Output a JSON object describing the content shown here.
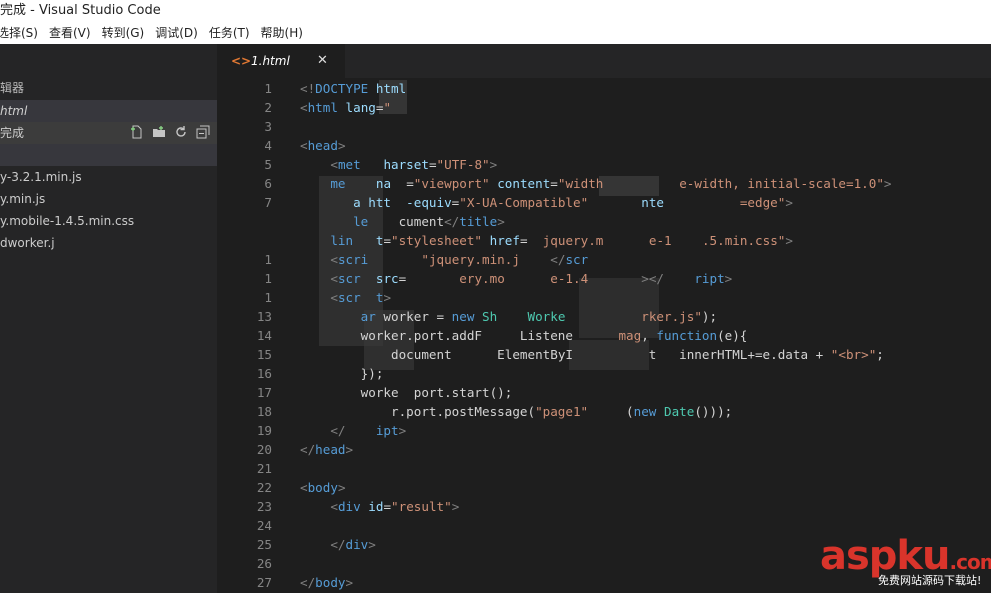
{
  "window": {
    "title": "完成 - Visual Studio Code"
  },
  "menu": [
    "选择(S)",
    "查看(V)",
    "转到(G)",
    "调试(D)",
    "任务(T)",
    "帮助(H)"
  ],
  "sidebar": {
    "header": "辑器",
    "open_editor": "html",
    "folder": "完成",
    "items": [
      "",
      "y-3.2.1.min.js",
      "y.min.js",
      "y.mobile-1.4.5.min.css",
      "dworker.j"
    ],
    "action_icons": [
      "new-file-icon",
      "new-folder-icon",
      "refresh-icon",
      "collapse-all-icon"
    ]
  },
  "tab": {
    "label": "1.html",
    "close": "✕"
  },
  "code": {
    "line_numbers": [
      "1",
      "2",
      "3",
      "4",
      "5",
      "6",
      "7",
      "",
      "",
      "1",
      "1",
      "1",
      "13",
      "14",
      "15",
      "16",
      "17",
      "18",
      "19",
      "20",
      "21",
      "22",
      "23",
      "24",
      "25",
      "26",
      "27"
    ],
    "lines": [
      [
        [
          "t-dim",
          "<!"
        ],
        [
          "t-tag",
          "DOCTYPE"
        ],
        [
          "",
          " "
        ],
        [
          "t-attr",
          "html"
        ]
      ],
      [
        [
          "t-dim",
          "<"
        ],
        [
          "t-tag",
          "html"
        ],
        [
          "",
          " "
        ],
        [
          "t-attr",
          "lang"
        ],
        [
          "",
          "="
        ],
        [
          "t-str",
          "\""
        ]
      ],
      [],
      [
        [
          "t-dim",
          "<"
        ],
        [
          "t-tag",
          "head"
        ],
        [
          "t-dim",
          ">"
        ]
      ],
      [
        [
          "",
          "    "
        ],
        [
          "t-dim",
          "<"
        ],
        [
          "t-tag",
          "met"
        ],
        [
          "",
          "   "
        ],
        [
          "t-attr",
          "harset"
        ],
        [
          "",
          "="
        ],
        [
          "t-str",
          "\"UTF-8\""
        ],
        [
          "t-dim",
          ">"
        ]
      ],
      [
        [
          "",
          "    "
        ],
        [
          "t-tag",
          "me"
        ],
        [
          "",
          "    "
        ],
        [
          "t-attr",
          "na"
        ],
        [
          "",
          "  ="
        ],
        [
          "t-str",
          "\"viewport\""
        ],
        [
          "",
          " "
        ],
        [
          "t-attr",
          "content"
        ],
        [
          "",
          "="
        ],
        [
          "t-str",
          "\"width          e-width, initial-scale=1.0\""
        ],
        [
          "t-dim",
          ">"
        ]
      ],
      [
        [
          "",
          "       "
        ],
        [
          "t-attr",
          "a htt  -equiv"
        ],
        [
          "",
          "="
        ],
        [
          "t-str",
          "\"X-UA-Compatible\""
        ],
        [
          "",
          "  "
        ],
        [
          "t-attr",
          "     nte"
        ],
        [
          "",
          "          "
        ],
        [
          "t-str",
          "=edge\""
        ],
        [
          "t-dim",
          ">"
        ]
      ],
      [
        [
          "",
          "       "
        ],
        [
          "t-tag",
          "le"
        ],
        [
          "",
          "    "
        ],
        [
          "",
          "cument"
        ],
        [
          "t-dim",
          "</"
        ],
        [
          "t-tag",
          "title"
        ],
        [
          "t-dim",
          ">"
        ]
      ],
      [
        [
          "",
          "    "
        ],
        [
          "t-tag",
          "lin"
        ],
        [
          "",
          "   "
        ],
        [
          "t-attr",
          "t"
        ],
        [
          "",
          "="
        ],
        [
          "t-str",
          "\"stylesheet\""
        ],
        [
          "",
          " "
        ],
        [
          "t-attr",
          "href"
        ],
        [
          "",
          "="
        ],
        [
          "t-str",
          "  jquery.m      e-1    .5.min.css\""
        ],
        [
          "t-dim",
          ">"
        ]
      ],
      [
        [
          "",
          "    "
        ],
        [
          "t-dim",
          "<"
        ],
        [
          "t-tag",
          "scri"
        ],
        [
          "",
          "       "
        ],
        [
          "t-str",
          "\"jquery.min.j    "
        ],
        [
          "t-dim",
          "</"
        ],
        [
          "t-tag",
          "scr"
        ]
      ],
      [
        [
          "",
          "    "
        ],
        [
          "t-dim",
          "<"
        ],
        [
          "t-tag",
          "scr"
        ],
        [
          "",
          "  "
        ],
        [
          "t-attr",
          "src"
        ],
        [
          "",
          "="
        ],
        [
          "t-str",
          "       ery.mo      e-1.4       "
        ],
        [
          "t-dim",
          "></"
        ],
        [
          "t-tag",
          "    ript"
        ],
        [
          "t-dim",
          ">"
        ]
      ],
      [
        [
          "",
          "    "
        ],
        [
          "t-dim",
          "<"
        ],
        [
          "t-tag",
          "scr  t"
        ],
        [
          "t-dim",
          ">"
        ]
      ],
      [
        [
          "",
          "        "
        ],
        [
          "t-kw",
          "ar"
        ],
        [
          "",
          " worker = "
        ],
        [
          "t-kw",
          "new"
        ],
        [
          "",
          " "
        ],
        [
          "t-type",
          "Sh    Worke"
        ],
        [
          "",
          "          "
        ],
        [
          "t-str",
          "rker.js\""
        ],
        [
          "",
          ");"
        ]
      ],
      [
        [
          "",
          "        "
        ],
        [
          "",
          "worker.port.addF     Listene      "
        ],
        [
          "t-str",
          "mag"
        ],
        [
          "",
          ", "
        ],
        [
          "t-kw",
          "function"
        ],
        [
          "",
          "(e){"
        ]
      ],
      [
        [
          "",
          "            "
        ],
        [
          "",
          "document      "
        ],
        [
          "",
          "ElementByI"
        ],
        [
          "",
          "          t   innerHTML+=e.data + "
        ],
        [
          "t-str",
          "\"<br>\""
        ],
        [
          "",
          ";"
        ]
      ],
      [
        [
          "",
          "        "
        ],
        [
          "",
          "});"
        ]
      ],
      [
        [
          "",
          "        "
        ],
        [
          "",
          "worke  port.start();"
        ]
      ],
      [
        [
          "",
          "        "
        ],
        [
          "",
          "    r.port.postMessage("
        ],
        [
          "t-str",
          "\"page1\""
        ],
        [
          "",
          "     ("
        ],
        [
          "t-kw",
          "new"
        ],
        [
          "",
          " "
        ],
        [
          "t-type",
          "Date"
        ],
        [
          "",
          "()));"
        ]
      ],
      [
        [
          "",
          "    "
        ],
        [
          "t-dim",
          "</"
        ],
        [
          "t-tag",
          "    ipt"
        ],
        [
          "t-dim",
          ">"
        ]
      ],
      [
        [
          "t-dim",
          "</"
        ],
        [
          "t-tag",
          "head"
        ],
        [
          "t-dim",
          ">"
        ]
      ],
      [],
      [
        [
          "t-dim",
          "<"
        ],
        [
          "t-tag",
          "body"
        ],
        [
          "t-dim",
          ">"
        ]
      ],
      [
        [
          "",
          "    "
        ],
        [
          "t-dim",
          "<"
        ],
        [
          "t-tag",
          "div"
        ],
        [
          "",
          " "
        ],
        [
          "t-attr",
          "id"
        ],
        [
          "",
          "="
        ],
        [
          "t-str",
          "\"result\""
        ],
        [
          "t-dim",
          ">"
        ]
      ],
      [],
      [
        [
          "",
          "    "
        ],
        [
          "t-dim",
          "</"
        ],
        [
          "t-tag",
          "div"
        ],
        [
          "t-dim",
          ">"
        ]
      ],
      [],
      [
        [
          "t-dim",
          "</"
        ],
        [
          "t-tag",
          "body"
        ],
        [
          "t-dim",
          ">"
        ]
      ]
    ]
  },
  "watermark": {
    "logo": "aspku",
    "tld": ".com",
    "tagline": "免费网站源码下载站!"
  }
}
